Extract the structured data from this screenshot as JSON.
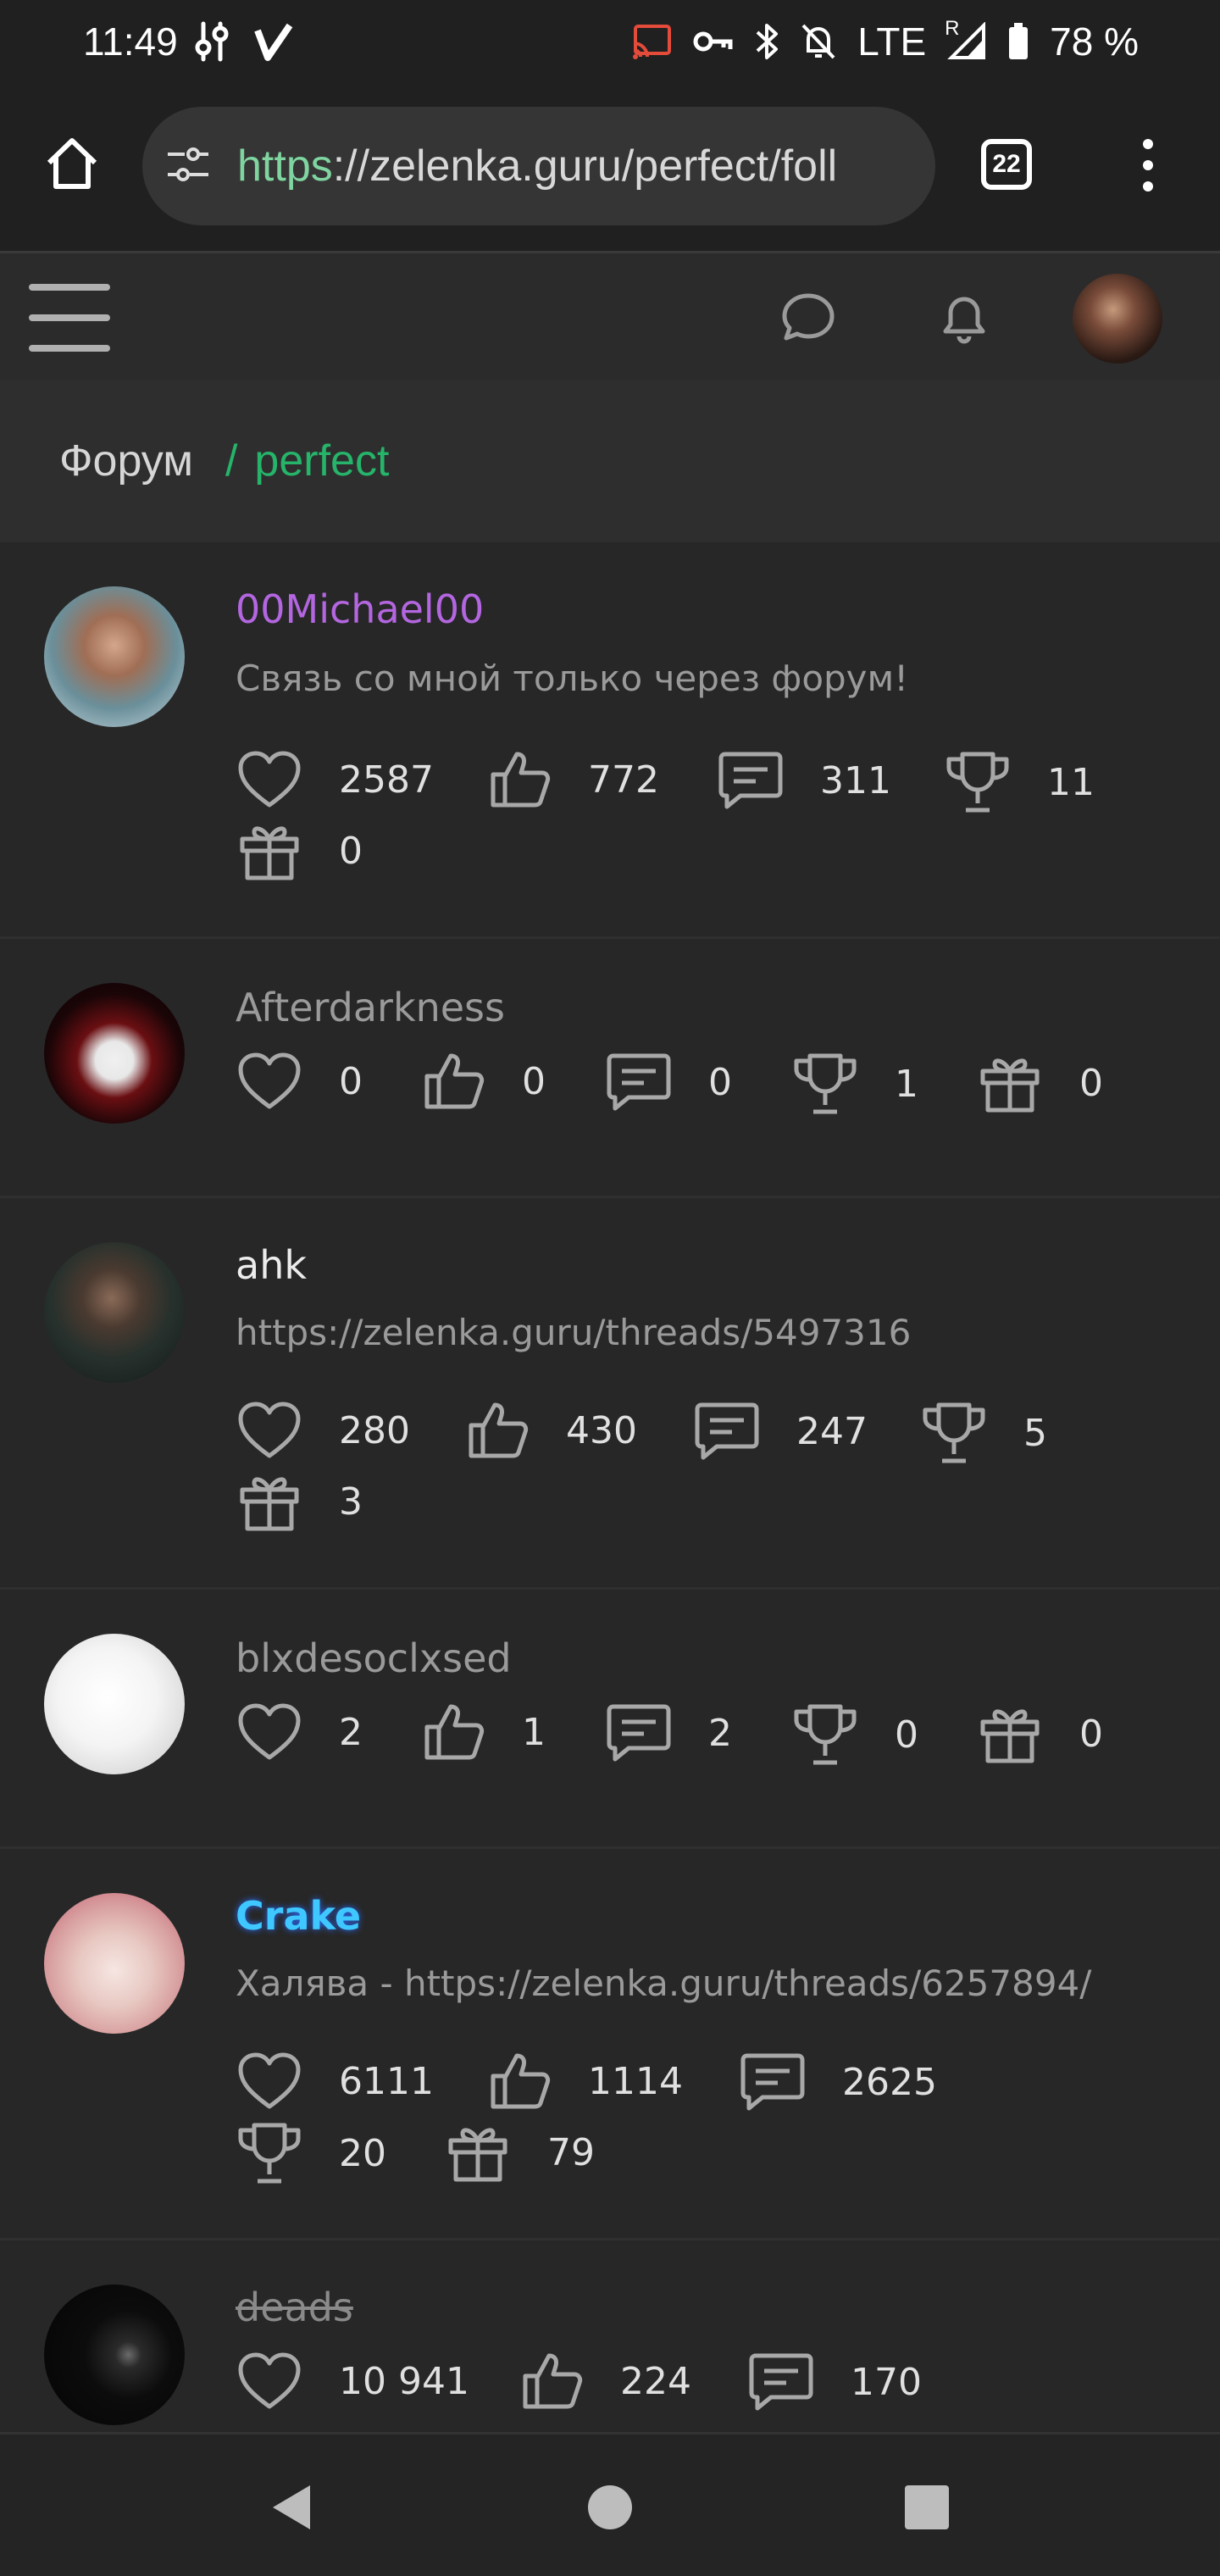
{
  "status_bar": {
    "time": "11:49",
    "network": "LTE",
    "roaming": "R",
    "battery": "78 %"
  },
  "browser": {
    "url_scheme": "https",
    "url_rest": "://zelenka.guru/perfect/foll",
    "tab_count": "22"
  },
  "breadcrumb": {
    "home": "Форум",
    "separator": "/",
    "current": "perfect"
  },
  "colors": {
    "accent": "#26b46a",
    "background": "#272727"
  },
  "users": [
    {
      "name": "00Michael00",
      "name_color": "#b366e0",
      "status": "Связь со мной только через форум!",
      "likes": "2587",
      "sympathies": "772",
      "messages": "311",
      "trophies": "11",
      "gifts": "0"
    },
    {
      "name": "Afterdarkness",
      "name_color": "#9a9a9a",
      "status": "",
      "likes": "0",
      "sympathies": "0",
      "messages": "0",
      "trophies": "1",
      "gifts": "0"
    },
    {
      "name": "ahk",
      "name_color": "#ececec",
      "status": "https://zelenka.guru/threads/5497316",
      "likes": "280",
      "sympathies": "430",
      "messages": "247",
      "trophies": "5",
      "gifts": "3"
    },
    {
      "name": "blxdesoclxsed",
      "name_color": "#9a9a9a",
      "status": "",
      "likes": "2",
      "sympathies": "1",
      "messages": "2",
      "trophies": "0",
      "gifts": "0"
    },
    {
      "name": "Crake",
      "name_color": "#3fc8ff",
      "status": "Халява - https://zelenka.guru/threads/6257894/",
      "likes": "6111",
      "sympathies": "1114",
      "messages": "2625",
      "trophies": "20",
      "gifts": "79"
    },
    {
      "name": "deads",
      "name_color": "#8a8a8a",
      "status": "",
      "likes": "10 941",
      "sympathies": "224",
      "messages": "170",
      "trophies": "",
      "gifts": ""
    }
  ]
}
